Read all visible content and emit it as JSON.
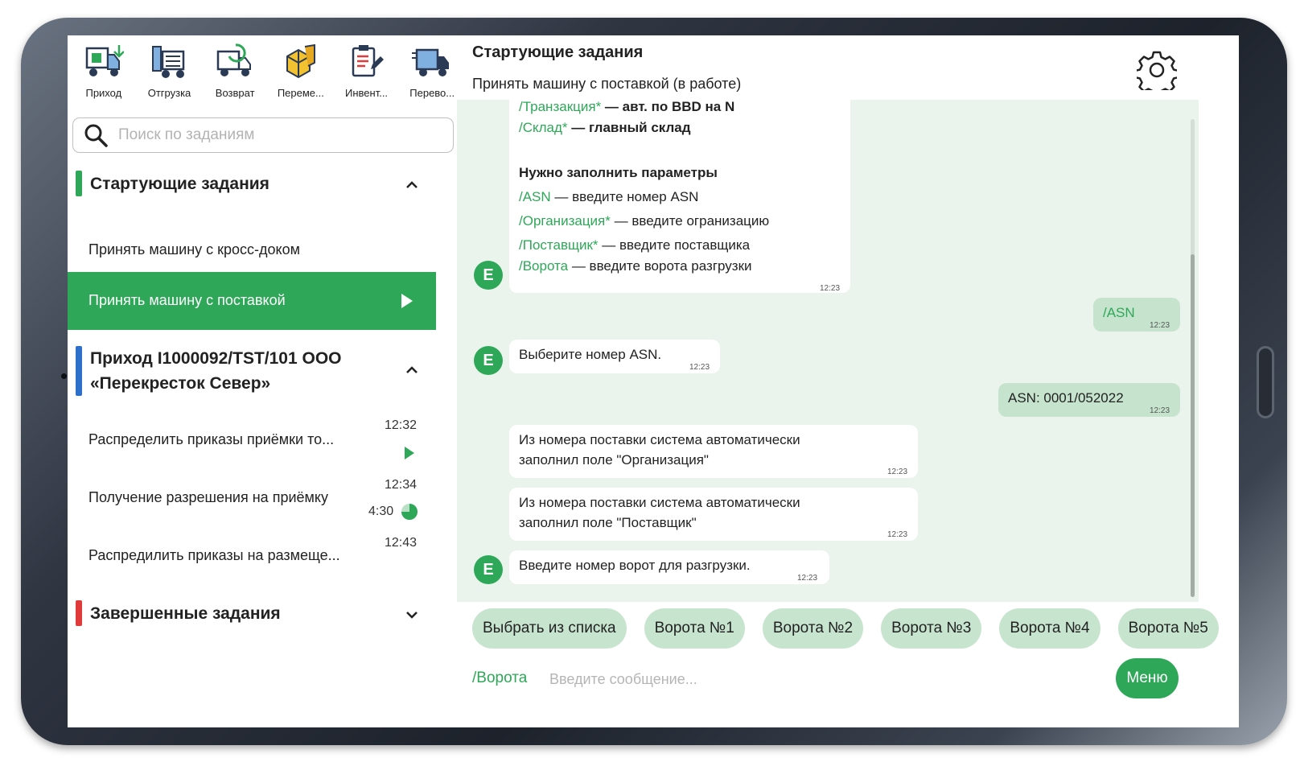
{
  "toolbar": {
    "items": [
      {
        "label": "Приход",
        "icon": "truck-receipt-icon"
      },
      {
        "label": "Отгрузка",
        "icon": "truck-shipment-icon"
      },
      {
        "label": "Возврат",
        "icon": "truck-return-icon"
      },
      {
        "label": "Переме...",
        "icon": "boxes-move-icon"
      },
      {
        "label": "Инвент...",
        "icon": "inventory-clipboard-icon"
      },
      {
        "label": "Перево...",
        "icon": "truck-transport-icon"
      }
    ]
  },
  "search": {
    "placeholder": "Поиск по заданиям"
  },
  "sections": {
    "starting": {
      "title": "Стартующие задания",
      "color": "#2ea858",
      "tasks": [
        {
          "label": "Принять машину с кросс-доком"
        },
        {
          "label": "Принять машину с поставкой"
        }
      ]
    },
    "receipt": {
      "title_line1": "Приход I1000092/TST/101 ООО",
      "title_line2": "«Перекресток Север»",
      "color": "#2e6fc9",
      "tasks": [
        {
          "label": "Распределить приказы приёмки то...",
          "time": "12:32"
        },
        {
          "label": "Получение разрешения на приёмку",
          "time": "12:34",
          "duration": "4:30"
        },
        {
          "label": "Распредилить приказы на размеще...",
          "time": "12:43"
        }
      ]
    },
    "completed": {
      "title": "Завершенные задания",
      "color": "#e03a3a"
    }
  },
  "header": {
    "title": "Стартующие задания",
    "subtitle": "Принять машину с поставкой (в работе)"
  },
  "chat": {
    "avatar_letter": "E",
    "msg1": {
      "line1_cmd": "/Транзакция*",
      "line1_text": " — авт. по BBD на N",
      "line2_cmd": "/Склад*",
      "line2_text": " — главный склад",
      "need": "Нужно заполнить параметры",
      "p1_cmd": "/ASN",
      "p1_text": " — введите номер ASN",
      "p2_cmd": "/Организация*",
      "p2_text": " — введите огранизацию",
      "p3_cmd": "/Поставщик*",
      "p3_text": " — введите поставщика",
      "p4_cmd": "/Ворота",
      "p4_text": " — введите ворота разгрузки",
      "time": "12:23"
    },
    "out1": {
      "text": "/ASN",
      "time": "12:23"
    },
    "msg2": {
      "text": "Выберите номер ASN.",
      "time": "12:23"
    },
    "out2": {
      "text": "ASN: 0001/052022",
      "time": "12:23"
    },
    "msg3": {
      "line1": "Из номера поставки система автоматически",
      "line2": "заполнил поле \"Организация\"",
      "time": "12:23"
    },
    "msg4": {
      "line1": "Из номера поставки система автоматически",
      "line2": "заполнил поле \"Поставщик\"",
      "time": "12:23"
    },
    "msg5": {
      "text": "Введите номер ворот для разгрузки.",
      "time": "12:23"
    }
  },
  "chips": [
    "Выбрать из списка",
    "Ворота №1",
    "Ворота №2",
    "Ворота №3",
    "Ворота №4",
    "Ворота №5"
  ],
  "composer": {
    "prefix": "/Ворота",
    "placeholder": "Введите сообщение...",
    "menu": "Меню"
  },
  "colors": {
    "accent": "#2ea858",
    "chat_bg": "#eaf4ec",
    "chip_bg": "#c7e4cf"
  }
}
